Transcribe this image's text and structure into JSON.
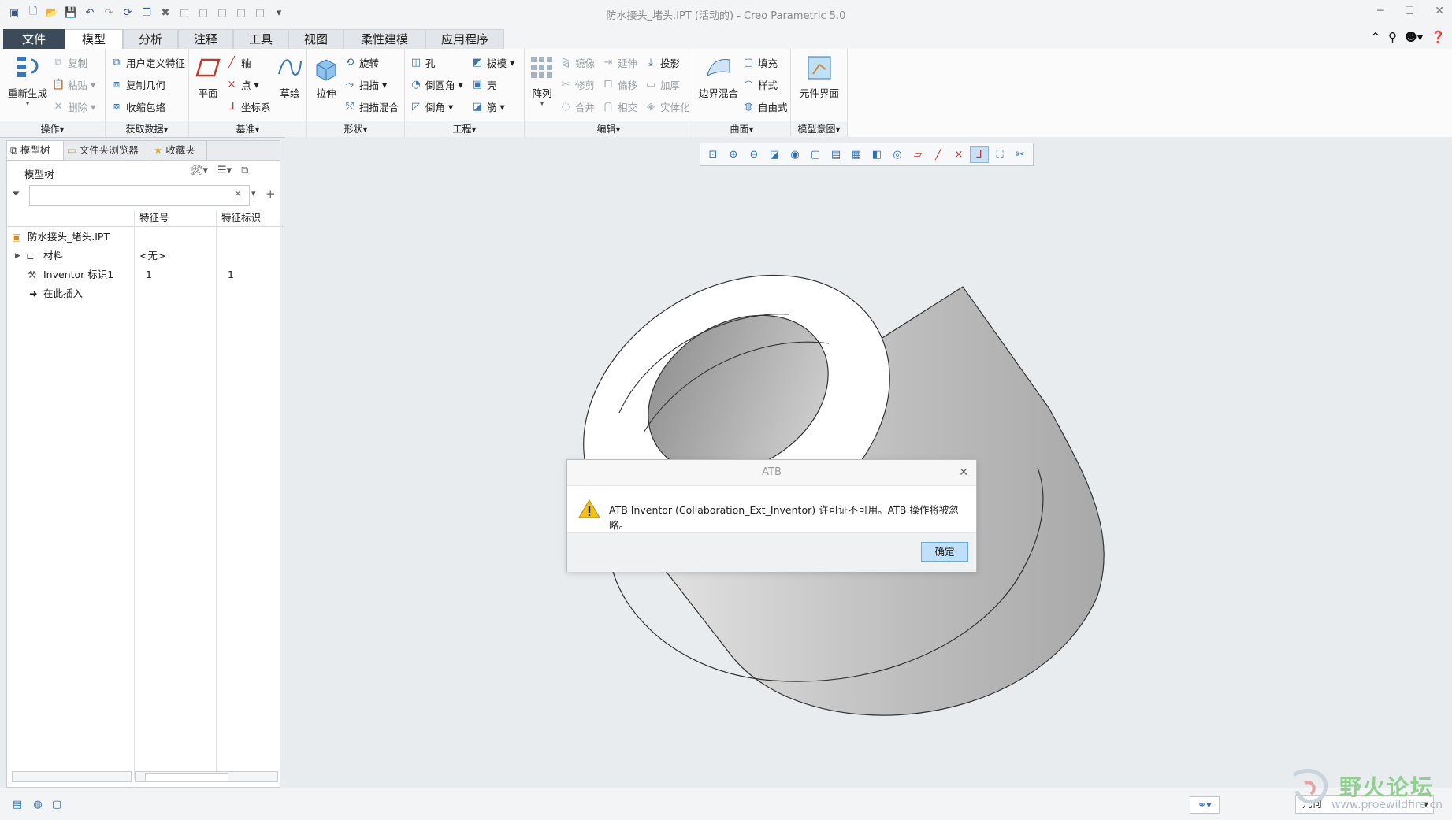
{
  "window": {
    "title": "防水接头_堵头.IPT (活动的) - Creo Parametric 5.0",
    "controls": [
      "minimize-icon",
      "maximize-icon",
      "close-icon"
    ]
  },
  "quick_access": [
    "menu-icon",
    "new-icon",
    "open-icon",
    "save-icon",
    "undo-icon",
    "redo-icon",
    "regenerate-icon",
    "windows-icon",
    "close-window-icon",
    "more-icon"
  ],
  "tabs": [
    "文件",
    "模型",
    "分析",
    "注释",
    "工具",
    "视图",
    "柔性建模",
    "应用程序"
  ],
  "active_tab": "模型",
  "ribbon": {
    "operations": {
      "label": "操作",
      "regenerate": "重新生成",
      "copy": "复制",
      "paste": "粘贴",
      "delete": "删除"
    },
    "get_data": {
      "label": "获取数据",
      "udf": "用户定义特征",
      "copy_geom": "复制几何",
      "shrinkwrap": "收缩包络"
    },
    "datum": {
      "label": "基准",
      "plane": "平面",
      "axis": "轴",
      "point": "点",
      "csys": "坐标系",
      "sketch": "草绘"
    },
    "shapes": {
      "label": "形状",
      "extrude": "拉伸",
      "revolve": "旋转",
      "sweep": "扫描",
      "swept_blend": "扫描混合"
    },
    "engineering": {
      "label": "工程",
      "hole": "孔",
      "round": "倒圆角",
      "chamfer": "倒角",
      "draft": "拔模",
      "shell": "壳",
      "rib": "筋"
    },
    "editing": {
      "label": "编辑",
      "pattern": "阵列",
      "mirror": "镜像",
      "extend": "延伸",
      "project": "投影",
      "trim": "修剪",
      "offset": "偏移",
      "thicken": "加厚",
      "merge": "合并",
      "intersect": "相交",
      "solidify": "实体化"
    },
    "surfaces": {
      "label": "曲面",
      "boundary_blend": "边界混合",
      "fill": "填充",
      "style": "样式",
      "freestyle": "自由式"
    },
    "model_intent": {
      "label": "模型意图",
      "component_interface": "元件界面"
    }
  },
  "left_panel": {
    "tabs": [
      "模型树",
      "文件夹浏览器",
      "收藏夹"
    ],
    "tree_title": "模型树",
    "filter_placeholder": "",
    "columns": [
      "特征号",
      "特征标识"
    ],
    "rows": [
      {
        "name": "防水接头_堵头.IPT",
        "feat_no": "",
        "feat_id": ""
      },
      {
        "name": "材料",
        "feat_no": "<无>",
        "feat_id": ""
      },
      {
        "name": "Inventor 标识1",
        "feat_no": "1",
        "feat_id": "1"
      },
      {
        "name": "在此插入",
        "feat_no": "",
        "feat_id": ""
      }
    ]
  },
  "view_toolbar": [
    "refit-icon",
    "zoom-in-icon",
    "zoom-out-icon",
    "repaint-icon",
    "shading-icon",
    "display-style-icon",
    "saved-views-icon",
    "view-manager-icon",
    "perspective-icon",
    "spin-center-icon",
    "datum-display-icon",
    "plane-display-icon",
    "axis-display-icon",
    "point-display-icon",
    "csys-display-icon",
    "annotation-display-icon",
    "more-icon"
  ],
  "dialog": {
    "title": "ATB",
    "message": "ATB Inventor (Collaboration_Ext_Inventor) 许可证不可用。ATB 操作将被忽略。",
    "ok": "确定"
  },
  "status": {
    "filter_value": "几何"
  },
  "watermark": {
    "text": "野火论坛",
    "url": "www.proewildfire.cn"
  }
}
